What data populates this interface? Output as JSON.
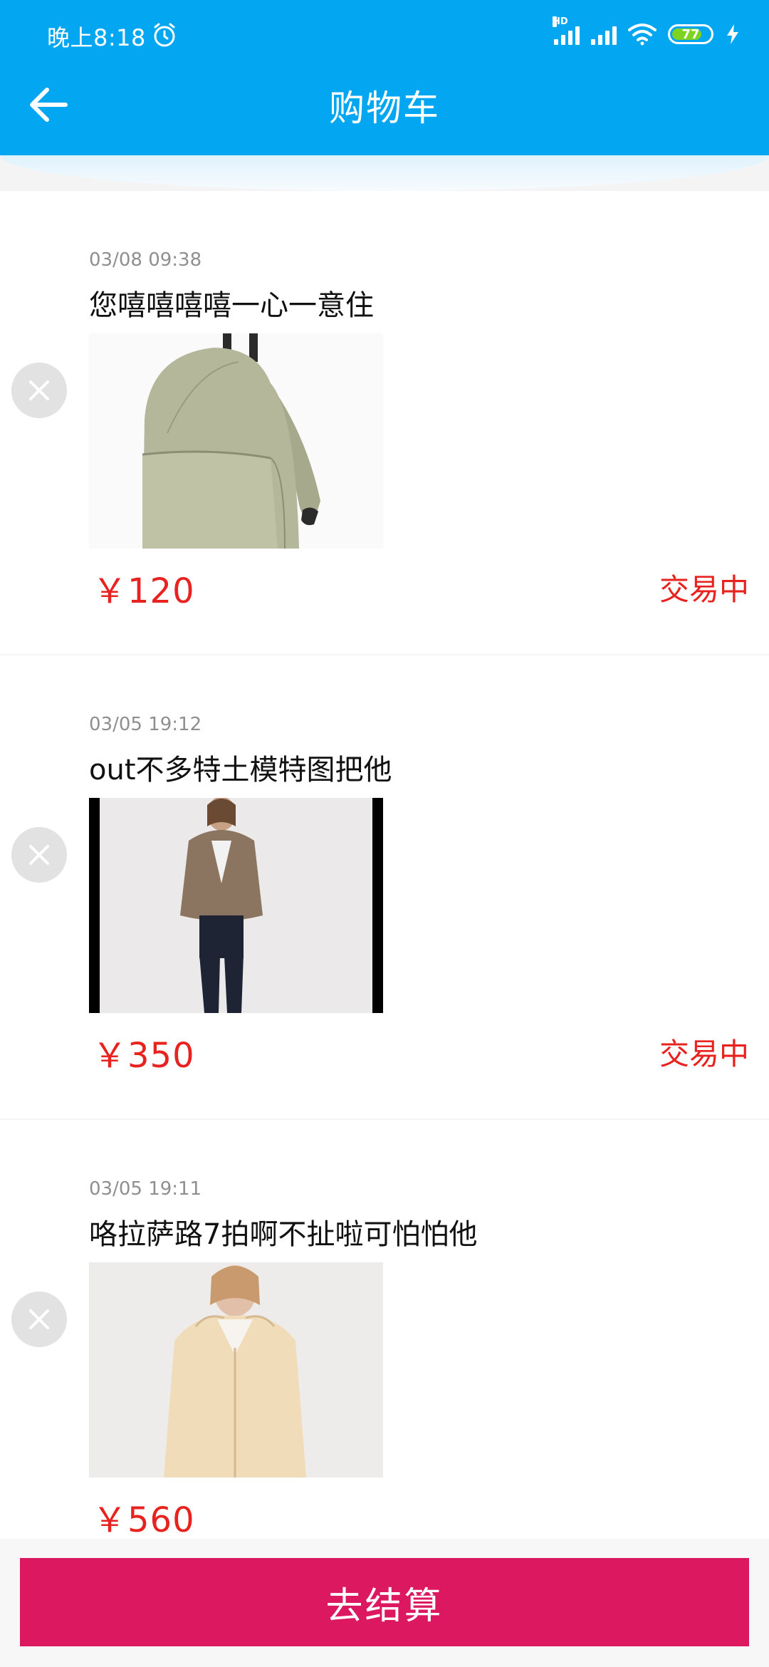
{
  "status_bar": {
    "time": "晚上8:18",
    "network_label": "HD",
    "battery": "77"
  },
  "header": {
    "title": "购物车"
  },
  "items": [
    {
      "time": "03/08 09:38",
      "title": "您嘻嘻嘻嘻一心一意住",
      "price": "￥120",
      "status": "交易中",
      "image_icon": "backpack-image"
    },
    {
      "time": "03/05 19:12",
      "title": "out不多特土模特图把他",
      "price": "￥350",
      "status": "交易中",
      "image_icon": "jacket-model-image"
    },
    {
      "time": "03/05 19:11",
      "title": "咯拉萨路7拍啊不扯啦可怕怕他",
      "price": "￥560",
      "status": "",
      "image_icon": "hoodie-model-image"
    }
  ],
  "checkout": {
    "label": "去结算"
  },
  "colors": {
    "header": "#03a6f0",
    "price": "#e8231f",
    "checkout": "#dc1960"
  }
}
